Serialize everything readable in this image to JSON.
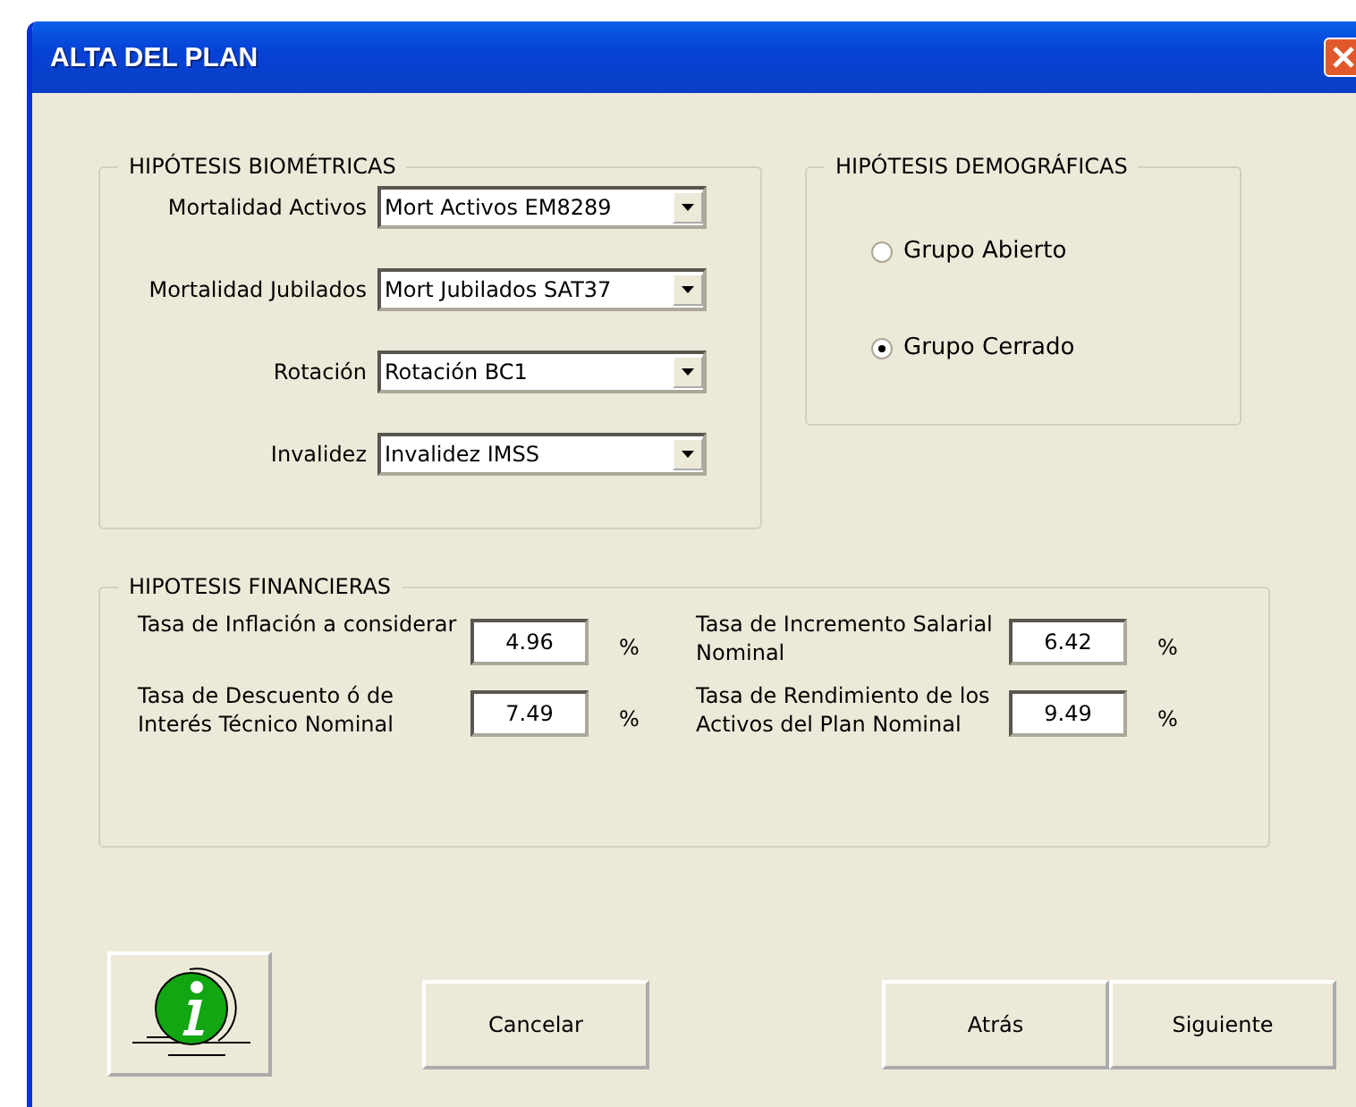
{
  "window": {
    "title": "ALTA DEL PLAN"
  },
  "biometricas": {
    "title": "HIPÓTESIS BIOMÉTRICAS",
    "rows": [
      {
        "label": "Mortalidad Activos",
        "value": "Mort Activos  EM8289"
      },
      {
        "label": "Mortalidad Jubilados",
        "value": "Mort Jubilados  SAT37"
      },
      {
        "label": "Rotación",
        "value": "Rotación  BC1"
      },
      {
        "label": "Invalidez",
        "value": "Invalidez  IMSS"
      }
    ]
  },
  "demograficas": {
    "title": "HIPÓTESIS DEMOGRÁFICAS",
    "options": [
      {
        "label": "Grupo Abierto",
        "selected": false
      },
      {
        "label": "Grupo Cerrado",
        "selected": true
      }
    ]
  },
  "financieras": {
    "title": "HIPOTESIS FINANCIERAS",
    "fields": [
      {
        "label": "Tasa de Inflación a considerar",
        "value": "4.96",
        "unit": "%"
      },
      {
        "label": "Tasa de Incremento Salarial Nominal",
        "value": "6.42",
        "unit": "%"
      },
      {
        "label": "Tasa de Descuento ó de Interés Técnico Nominal",
        "value": "7.49",
        "unit": "%"
      },
      {
        "label": "Tasa de Rendimiento de los Activos del Plan Nominal",
        "value": "9.49",
        "unit": "%"
      }
    ]
  },
  "buttons": [
    {
      "kind": "info"
    },
    {
      "kind": "text",
      "label": "Cancelar"
    },
    {
      "kind": "text",
      "label": "Atrás"
    },
    {
      "kind": "text",
      "label": "Siguiente"
    }
  ]
}
